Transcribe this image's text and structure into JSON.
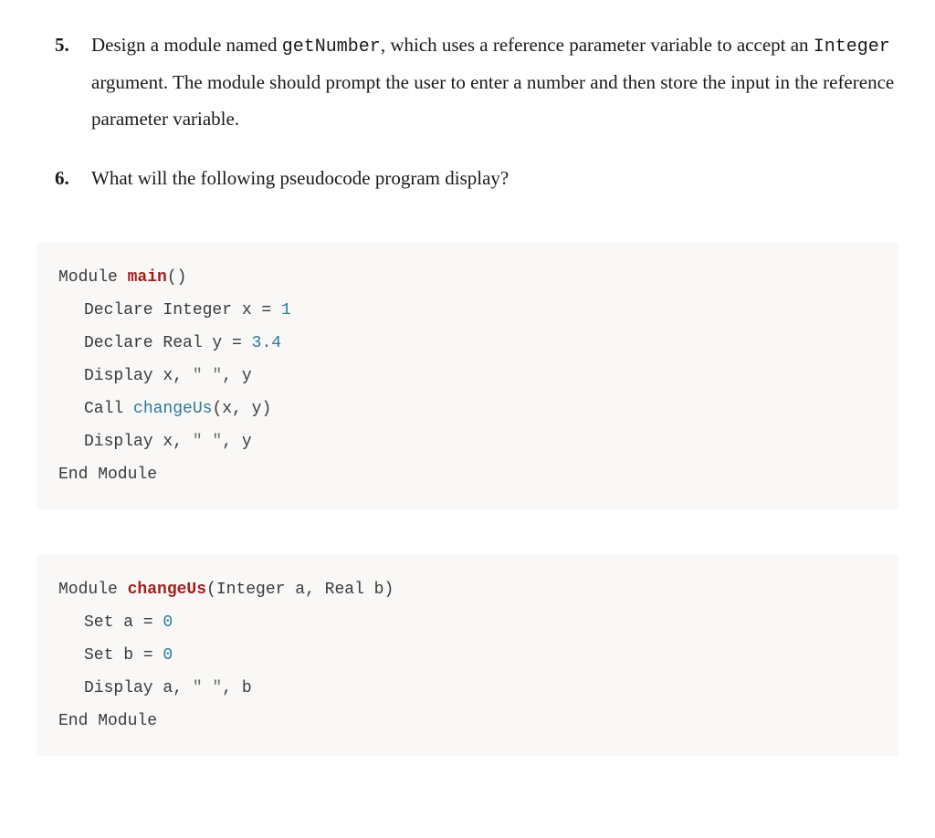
{
  "questions": [
    {
      "number": "5.",
      "parts": [
        {
          "t": "Design a module named "
        },
        {
          "t": "getNumber",
          "code": true
        },
        {
          "t": ", which uses a reference parameter variable to accept an "
        },
        {
          "t": "Integer",
          "code": true
        },
        {
          "t": " argument. The module should prompt the user to enter a number and then store the input in the reference parameter variable."
        }
      ]
    },
    {
      "number": "6.",
      "parts": [
        {
          "t": "What will the following pseudocode program display?"
        }
      ]
    }
  ],
  "code1": {
    "l0": {
      "a": "Module ",
      "b": "main",
      "c": "()"
    },
    "l1": {
      "a": "Declare Integer x = ",
      "b": "1"
    },
    "l2": {
      "a": "Declare Real y = ",
      "b": "3.4"
    },
    "l3": {
      "a": "Display x, ",
      "b": "\" \"",
      "c": ", y"
    },
    "l4": {
      "a": "Call ",
      "b": "changeUs",
      "c": "(x, y)"
    },
    "l5": {
      "a": "Display x, ",
      "b": "\" \"",
      "c": ", y"
    },
    "l6": {
      "a": "End Module"
    }
  },
  "code2": {
    "l0": {
      "a": "Module ",
      "b": "changeUs",
      "c": "(Integer a, Real b)"
    },
    "l1": {
      "a": "Set a = ",
      "b": "0"
    },
    "l2": {
      "a": "Set b = ",
      "b": "0"
    },
    "l3": {
      "a": "Display a, ",
      "b": "\" \"",
      "c": ", b"
    },
    "l4": {
      "a": "End Module"
    }
  }
}
